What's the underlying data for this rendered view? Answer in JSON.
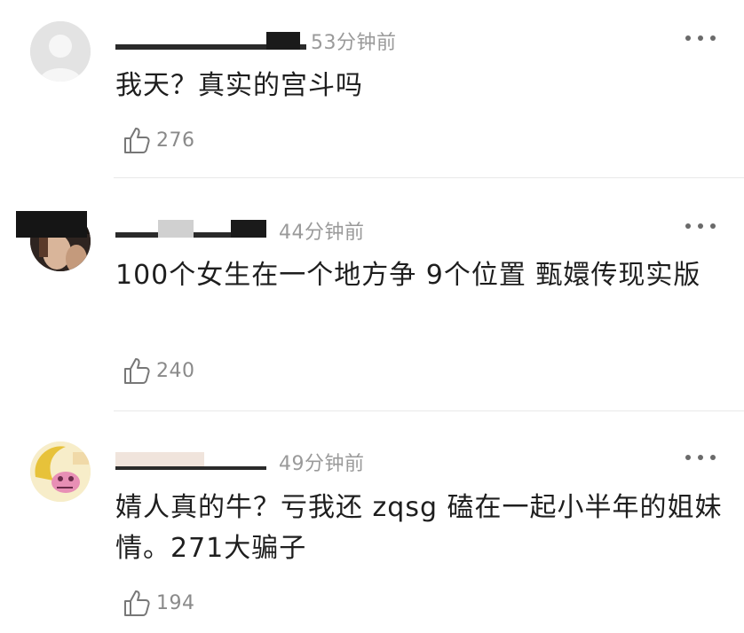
{
  "comments": [
    {
      "time": "53分钟前",
      "text": "我天？真实的宫斗吗",
      "likes": "276",
      "avatar": "default-gray-avatar"
    },
    {
      "time": "44分钟前",
      "text": "100个女生在一个地方争 9个位置 甄嬛传现实版",
      "likes": "240",
      "avatar": "photo-avatar"
    },
    {
      "time": "49分钟前",
      "text": "婧人真的牛？亏我还 zqsg 磕在一起小半年的姐妹情。271大骗子",
      "likes": "194",
      "avatar": "cartoon-avatar"
    }
  ],
  "icons": {
    "like": "thumbs-up-icon",
    "more": "more-dots-icon"
  },
  "colors": {
    "time": "#9a9a9a",
    "text": "#1e1e1e",
    "like_count": "#8a8a8a",
    "divider": "#e9e9e9"
  }
}
